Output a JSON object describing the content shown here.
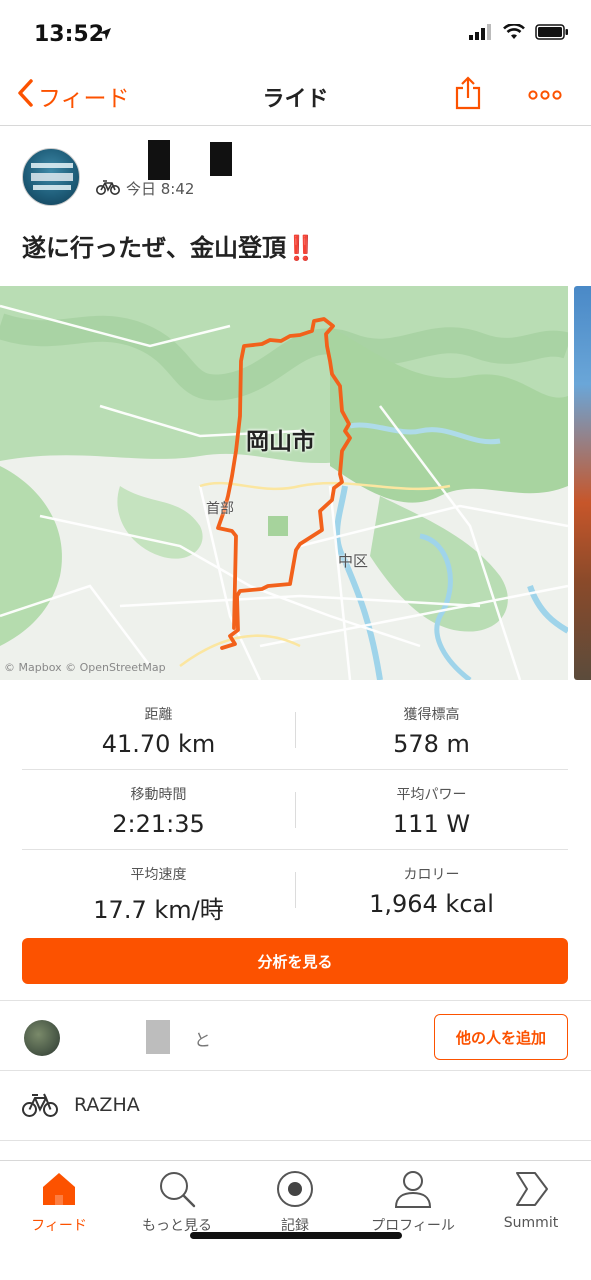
{
  "status_bar": {
    "time": "13:52"
  },
  "nav": {
    "back_label": "フィード",
    "title": "ライド"
  },
  "activity": {
    "time": "今日 8:42",
    "title": "遂に行ったぜ、金山登頂",
    "title_emoji": "‼️"
  },
  "map": {
    "city_label": "岡山市",
    "ward_label": "中区",
    "north_label": "首部",
    "attribution": "© Mapbox © OpenStreetMap"
  },
  "stats": [
    {
      "left": {
        "label": "距離",
        "value": "41.70 km"
      },
      "right": {
        "label": "獲得標高",
        "value": "578 m"
      }
    },
    {
      "left": {
        "label": "移動時間",
        "value": "2:21:35"
      },
      "right": {
        "label": "平均パワー",
        "value": "111 W"
      }
    },
    {
      "left": {
        "label": "平均速度",
        "value": "17.7 km/時"
      },
      "right": {
        "label": "カロリー",
        "value": "1,964 kcal"
      }
    }
  ],
  "analyze_button": "分析を見る",
  "with_section": {
    "text": "と",
    "add_button": "他の人を追加"
  },
  "gear": {
    "name": "RAZHA"
  },
  "tabs": [
    {
      "label": "フィード",
      "icon": "home-icon"
    },
    {
      "label": "もっと見る",
      "icon": "search-icon"
    },
    {
      "label": "記録",
      "icon": "record-icon"
    },
    {
      "label": "プロフィール",
      "icon": "profile-icon"
    },
    {
      "label": "Summit",
      "icon": "summit-icon"
    }
  ],
  "colors": {
    "accent": "#fc5200",
    "route": "#f2611b"
  }
}
